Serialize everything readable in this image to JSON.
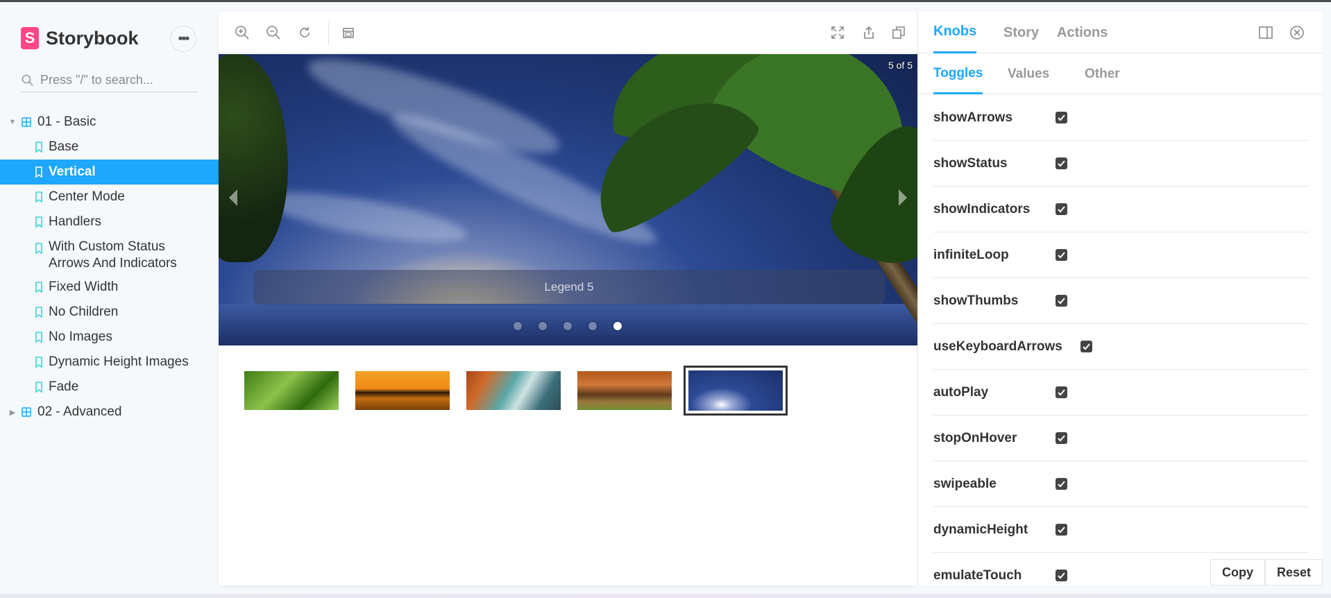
{
  "app": {
    "name": "Storybook",
    "logo_letter": "S",
    "more_icon": "ellipsis-icon"
  },
  "search": {
    "placeholder": "Press \"/\" to search..."
  },
  "tree": {
    "group1": {
      "label": "01 - Basic",
      "expanded": true
    },
    "stories": [
      {
        "label": "Base"
      },
      {
        "label": "Vertical",
        "selected": true
      },
      {
        "label": "Center Mode"
      },
      {
        "label": "Handlers"
      },
      {
        "label": "With Custom Status Arrows And Indicators"
      },
      {
        "label": "Fixed Width"
      },
      {
        "label": "No Children"
      },
      {
        "label": "No Images"
      },
      {
        "label": "Dynamic Height Images"
      },
      {
        "label": "Fade"
      }
    ],
    "group2": {
      "label": "02 - Advanced",
      "expanded": false
    }
  },
  "toolbar": {
    "icons": [
      "zoom-in-icon",
      "zoom-out-icon",
      "reset-zoom-icon",
      "background-icon",
      "fullscreen-icon",
      "share-icon",
      "copy-link-icon"
    ]
  },
  "carousel": {
    "status": "5 of 5",
    "legend": "Legend 5",
    "slide_count": 5,
    "active_slide": 5,
    "thumbnail_count": 5
  },
  "panel": {
    "tabs": [
      "Knobs",
      "Story",
      "Actions"
    ],
    "active_tab": "Knobs",
    "sub_tabs": [
      "Toggles",
      "Values",
      "Other"
    ],
    "active_sub_tab": "Toggles",
    "knobs": [
      {
        "name": "showArrows",
        "checked": true
      },
      {
        "name": "showStatus",
        "checked": true
      },
      {
        "name": "showIndicators",
        "checked": true
      },
      {
        "name": "infiniteLoop",
        "checked": true
      },
      {
        "name": "showThumbs",
        "checked": true
      },
      {
        "name": "useKeyboardArrows",
        "checked": true
      },
      {
        "name": "autoPlay",
        "checked": true
      },
      {
        "name": "stopOnHover",
        "checked": true
      },
      {
        "name": "swipeable",
        "checked": true
      },
      {
        "name": "dynamicHeight",
        "checked": true
      },
      {
        "name": "emulateTouch",
        "checked": true
      }
    ],
    "copy_label": "Copy",
    "reset_label": "Reset"
  },
  "colors": {
    "accent": "#1ea7fd",
    "brand": "#ff4785"
  }
}
